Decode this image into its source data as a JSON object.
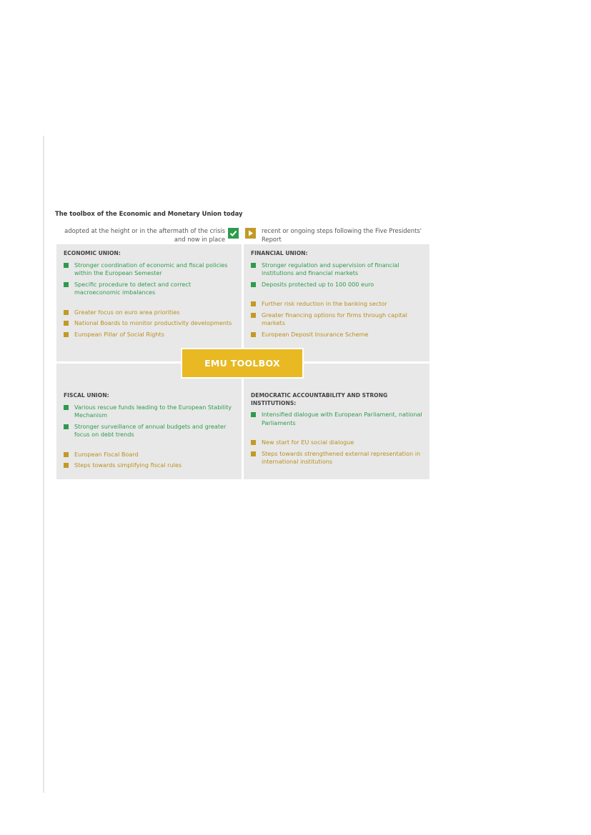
{
  "figure": {
    "title": "The toolbox of the Economic and Monetary Union today",
    "legend_adopted": "adopted at the height or in the aftermath of the crisis and now in place",
    "legend_recent": "recent or ongoing steps following the Five Presidents' Report",
    "center_label": "EMU TOOLBOX"
  },
  "colors": {
    "adopted": "#2e9b4f",
    "recent": "#c29a25",
    "center": "#e8b923",
    "panel": "#e8e8e8"
  },
  "economic": {
    "heading": "ECONOMIC UNION:",
    "adopted": [
      "Stronger coordination of economic and fiscal policies within the European Semester",
      "Specific procedure to detect and correct macroeconomic imbalances"
    ],
    "recent": [
      "Greater focus on euro area priorities",
      "National Boards to monitor productivity developments",
      "European Pillar of Social Rights"
    ]
  },
  "financial": {
    "heading": "FINANCIAL UNION:",
    "adopted": [
      "Stronger regulation and supervision of financial institutions and financial markets",
      "Deposits protected up to 100 000 euro"
    ],
    "recent": [
      "Further risk reduction in the banking sector",
      "Greater financing options for firms through capital markets",
      "European Deposit Insurance Scheme"
    ]
  },
  "fiscal": {
    "heading": "FISCAL UNION:",
    "adopted": [
      "Various rescue funds leading to the European Stability Mechanism",
      "Stronger surveillance of annual budgets and greater focus on debt trends"
    ],
    "recent": [
      "European Fiscal Board",
      "Steps towards simplifying fiscal rules"
    ]
  },
  "democratic": {
    "heading": "DEMOCRATIC ACCOUNTABILITY AND STRONG INSTITUTIONS:",
    "adopted": [
      "Intensified dialogue with European Parliament, national Parliaments"
    ],
    "recent": [
      "New start for EU social dialogue",
      "Steps towards strengthened external representation in international institutions"
    ]
  }
}
